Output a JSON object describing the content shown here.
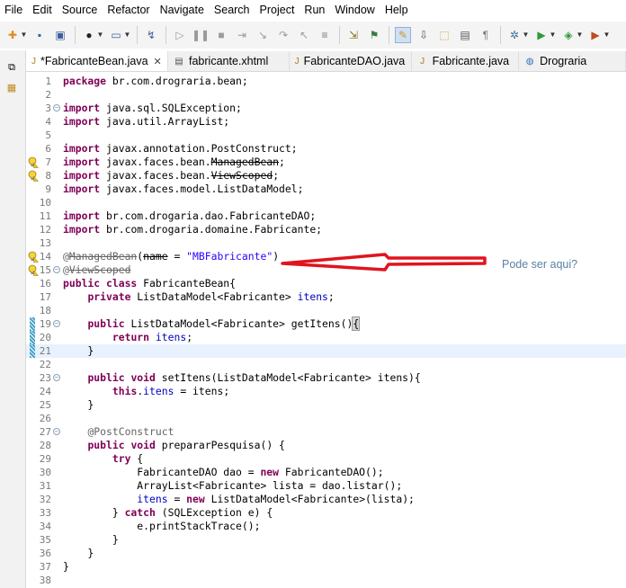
{
  "menu": [
    "File",
    "Edit",
    "Source",
    "Refactor",
    "Navigate",
    "Search",
    "Project",
    "Run",
    "Window",
    "Help"
  ],
  "toolbar": {
    "icons": [
      {
        "name": "new-icon",
        "glyph": "✚"
      },
      {
        "name": "save-icon",
        "glyph": "▪"
      },
      {
        "name": "save-all-icon",
        "glyph": "▣"
      },
      {
        "name": "user-icon",
        "glyph": "●"
      },
      {
        "name": "console-icon",
        "glyph": "▭"
      },
      {
        "name": "debug-skip-icon",
        "glyph": "↯"
      },
      {
        "name": "resume-icon",
        "glyph": "▷"
      },
      {
        "name": "suspend-icon",
        "glyph": "❚❚"
      },
      {
        "name": "terminate-icon",
        "glyph": "■"
      },
      {
        "name": "disconnect-icon",
        "glyph": "⇥"
      },
      {
        "name": "step-into-icon",
        "glyph": "↘"
      },
      {
        "name": "step-over-icon",
        "glyph": "↷"
      },
      {
        "name": "step-return-icon",
        "glyph": "↖"
      },
      {
        "name": "drop-to-frame-icon",
        "glyph": "≡"
      },
      {
        "name": "use-step-filters-icon",
        "glyph": "⇲"
      },
      {
        "name": "toggle-breadcrumb-icon",
        "glyph": "⚑"
      },
      {
        "name": "mark-occurrences-icon",
        "glyph": "✎"
      },
      {
        "name": "next-annotation-icon",
        "glyph": "⇩"
      },
      {
        "name": "open-type-icon",
        "glyph": "⬚"
      },
      {
        "name": "open-task-icon",
        "glyph": "▤"
      },
      {
        "name": "show-whitespace-icon",
        "glyph": "¶"
      },
      {
        "name": "debug-icon",
        "glyph": "✲"
      },
      {
        "name": "run-icon",
        "glyph": "▶"
      },
      {
        "name": "coverage-icon",
        "glyph": "◈"
      },
      {
        "name": "external-tools-icon",
        "glyph": "▶"
      }
    ]
  },
  "tabs": [
    {
      "label": "*FabricanteBean.java",
      "active": true,
      "icon": "java-file-icon",
      "closable": true
    },
    {
      "label": "fabricante.xhtml",
      "active": false,
      "icon": "xhtml-file-icon",
      "closable": false
    },
    {
      "label": "FabricanteDAO.java",
      "active": false,
      "icon": "java-file-icon",
      "closable": false
    },
    {
      "label": "Fabricante.java",
      "active": false,
      "icon": "java-file-icon",
      "closable": false
    },
    {
      "label": "Drograria",
      "active": false,
      "icon": "globe-icon",
      "closable": false
    }
  ],
  "editor": {
    "lines": [
      {
        "n": "1",
        "html": "<span class=\"kw\">package</span> br.com.drograria.bean;"
      },
      {
        "n": "2",
        "html": ""
      },
      {
        "n": "3",
        "fold": true,
        "html": "<span class=\"kw\">import</span> java.sql.SQLException;"
      },
      {
        "n": "4",
        "html": "<span class=\"kw\">import</span> java.util.ArrayList;"
      },
      {
        "n": "5",
        "html": ""
      },
      {
        "n": "6",
        "html": "<span class=\"kw\">import</span> javax.annotation.PostConstruct;"
      },
      {
        "n": "7",
        "warn": true,
        "html": "<span class=\"kw\">import</span> javax.faces.bean.<span class=\"strike\">ManagedBean</span>;"
      },
      {
        "n": "8",
        "warn": true,
        "html": "<span class=\"kw\">import</span> javax.faces.bean.<span class=\"strike\">ViewScoped</span>;"
      },
      {
        "n": "9",
        "html": "<span class=\"kw\">import</span> javax.faces.model.ListDataModel;"
      },
      {
        "n": "10",
        "html": ""
      },
      {
        "n": "11",
        "html": "<span class=\"kw\">import</span> br.com.drogaria.dao.FabricanteDAO;"
      },
      {
        "n": "12",
        "html": "<span class=\"kw\">import</span> br.com.drogaria.domaine.Fabricante;"
      },
      {
        "n": "13",
        "html": ""
      },
      {
        "n": "14",
        "warn": true,
        "html": "<span class=\"ann\">@<span class=\"strike\">ManagedBean</span></span>(<span class=\"strike\">name</span> = <span class=\"str\">\"MBFabricante\"</span>)"
      },
      {
        "n": "15",
        "fold": true,
        "warn": true,
        "html": "<span class=\"ann\">@<span class=\"strike\">ViewScoped</span></span>"
      },
      {
        "n": "16",
        "html": "<span class=\"kw\">public class</span> FabricanteBean{"
      },
      {
        "n": "17",
        "html": "    <span class=\"kw\">private</span> ListDataModel&lt;Fabricante&gt; <span class=\"fld\">itens</span>;"
      },
      {
        "n": "18",
        "html": ""
      },
      {
        "n": "19",
        "fold": true,
        "change": true,
        "html": "    <span class=\"kw\">public</span> ListDataModel&lt;Fabricante&gt; getItens()<span class=\"hl\">{</span>"
      },
      {
        "n": "20",
        "change": true,
        "html": "        <span class=\"kw\">return</span> <span class=\"fld\">itens</span>;"
      },
      {
        "n": "21",
        "change": true,
        "current": true,
        "html": "    }"
      },
      {
        "n": "22",
        "html": ""
      },
      {
        "n": "23",
        "fold": true,
        "html": "    <span class=\"kw\">public void</span> setItens(ListDataModel&lt;Fabricante&gt; itens){"
      },
      {
        "n": "24",
        "html": "        <span class=\"kw\">this</span>.<span class=\"fld\">itens</span> = itens;"
      },
      {
        "n": "25",
        "html": "    }"
      },
      {
        "n": "26",
        "html": ""
      },
      {
        "n": "27",
        "fold": true,
        "html": "    <span class=\"ann\">@PostConstruct</span>"
      },
      {
        "n": "28",
        "html": "    <span class=\"kw\">public void</span> prepararPesquisa() {"
      },
      {
        "n": "29",
        "html": "        <span class=\"kw\">try</span> {"
      },
      {
        "n": "30",
        "html": "            FabricanteDAO dao = <span class=\"kw\">new</span> FabricanteDAO();"
      },
      {
        "n": "31",
        "html": "            ArrayList&lt;Fabricante&gt; lista = dao.listar();"
      },
      {
        "n": "32",
        "html": "            <span class=\"fld\">itens</span> = <span class=\"kw\">new</span> ListDataModel&lt;Fabricante&gt;(lista);"
      },
      {
        "n": "33",
        "html": "        } <span class=\"kw\">catch</span> (SQLException e) {"
      },
      {
        "n": "34",
        "html": "            e.printStackTrace();"
      },
      {
        "n": "35",
        "html": "        }"
      },
      {
        "n": "36",
        "html": "    }"
      },
      {
        "n": "37",
        "html": "}"
      },
      {
        "n": "38",
        "html": ""
      }
    ]
  },
  "annotation": {
    "note": "Pode ser aqui?",
    "arrow_color": "#e0141e"
  }
}
